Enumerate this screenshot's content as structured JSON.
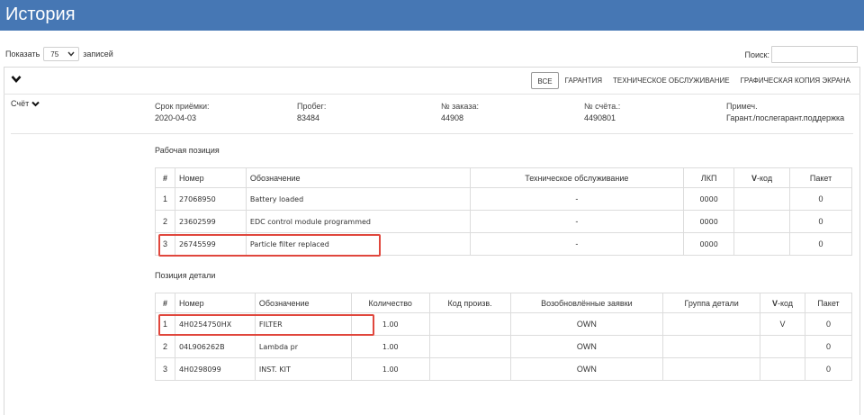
{
  "header": {
    "title": "История"
  },
  "controls": {
    "show_prefix": "Показать",
    "show_value": "75",
    "show_suffix": "записей",
    "search_label": "Поиск:",
    "search_value": ""
  },
  "filters": [
    {
      "label": "ВСЕ",
      "active": true
    },
    {
      "label": "ГАРАНТИЯ",
      "active": false
    },
    {
      "label": "ТЕХНИЧЕСКОЕ ОБСЛУЖИВАНИЕ",
      "active": false
    },
    {
      "label": "ГРАФИЧЕСКАЯ КОПИЯ ЭКРАНА",
      "active": false
    }
  ],
  "record": {
    "account_label": "Счёт",
    "receipt_label": "Срок приёмки:",
    "receipt_value": "2020-04-03",
    "mileage_label": "Пробег:",
    "mileage_value": "83484",
    "order_label": "№ заказа:",
    "order_value": "44908",
    "invoice_label": "№ счёта.:",
    "invoice_value": "4490801",
    "note_label": "Примеч.",
    "note_value": "Гарант./послегарант.поддержка"
  },
  "work_positions": {
    "title": "Рабочая позиция",
    "headers": {
      "num": "#",
      "number": "Номер",
      "designation": "Обозначение",
      "maintenance": "Техническое обслуживание",
      "lkp": "ЛКП",
      "v_bold": "V",
      "v_rest": "-код",
      "package": "Пакет"
    },
    "rows": [
      {
        "num": "1",
        "number": "27068950",
        "designation": "Battery loaded",
        "maintenance": "-",
        "lkp": "0000",
        "vcode": "",
        "package": "0"
      },
      {
        "num": "2",
        "number": "23602599",
        "designation": "EDC control module programmed",
        "maintenance": "-",
        "lkp": "0000",
        "vcode": "",
        "package": "0"
      },
      {
        "num": "3",
        "number": "26745599",
        "designation": "Particle filter replaced",
        "maintenance": "-",
        "lkp": "0000",
        "vcode": "",
        "package": "0"
      }
    ]
  },
  "parts": {
    "title": "Позиция детали",
    "headers": {
      "num": "#",
      "number": "Номер",
      "designation": "Обозначение",
      "quantity": "Количество",
      "prod_code": "Код произв.",
      "renewed": "Возобновлённые заявки",
      "group": "Группа детали",
      "v_bold": "V",
      "v_rest": "-код",
      "package": "Пакет"
    },
    "rows": [
      {
        "num": "1",
        "number": "4H0254750HX",
        "designation": "FILTER",
        "quantity": "1.00",
        "prod_code": "",
        "renewed": "OWN",
        "group": "",
        "vcode": "V",
        "package": "0"
      },
      {
        "num": "2",
        "number": "04L906262B",
        "designation": "Lambda pr",
        "quantity": "1.00",
        "prod_code": "",
        "renewed": "OWN",
        "group": "",
        "vcode": "",
        "package": "0"
      },
      {
        "num": "3",
        "number": "4H0298099",
        "designation": "INST. KIT",
        "quantity": "1.00",
        "prod_code": "",
        "renewed": "OWN",
        "group": "",
        "vcode": "",
        "package": "0"
      }
    ]
  },
  "colors": {
    "header_bg": "#4677b4",
    "highlight": "#e0473d"
  }
}
